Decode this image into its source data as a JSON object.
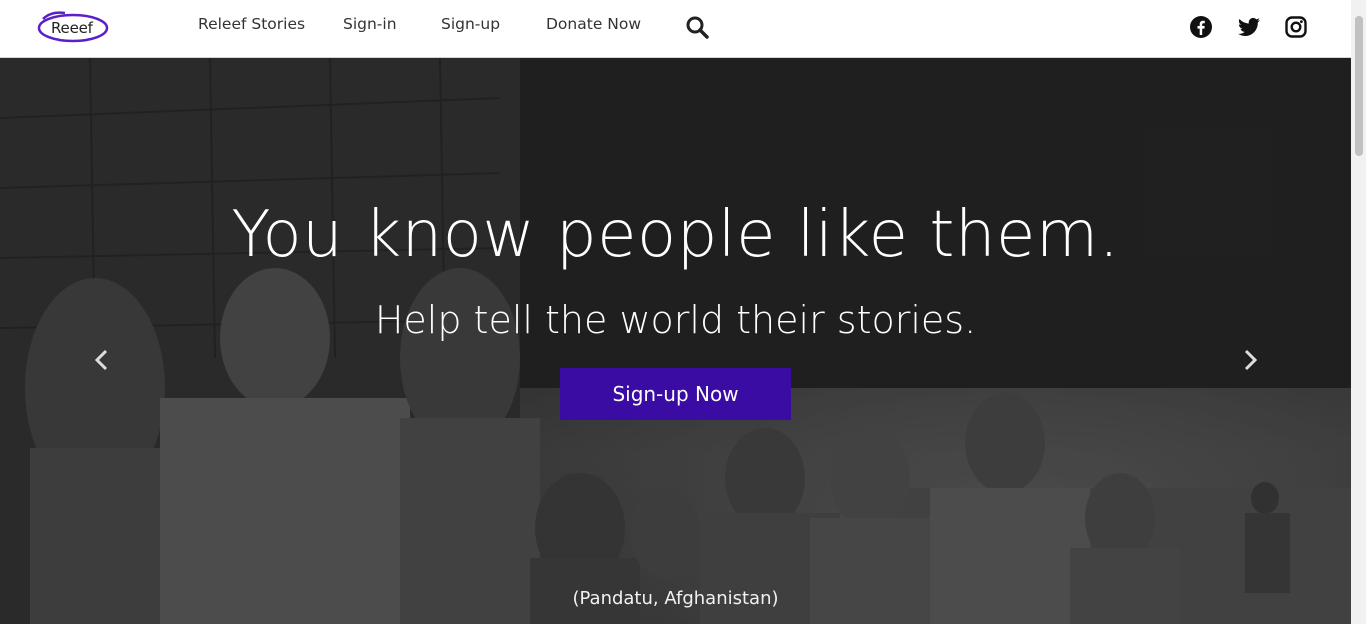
{
  "brand": {
    "logo_text": "Reeef",
    "accent": "#3a0ca3",
    "logo_ring_color": "#5b1fc9"
  },
  "nav": {
    "links": [
      "Releef Stories",
      "Sign-in",
      "Sign-up",
      "Donate Now"
    ],
    "search_icon": "search-icon",
    "social_icons": [
      "facebook-icon",
      "twitter-icon",
      "instagram-icon"
    ]
  },
  "hero": {
    "headline": "You know people like them.",
    "subhead": "Help tell the world their stories.",
    "cta_label": "Sign-up Now",
    "caption": "(Pandatu, Afghanistan)",
    "prev_icon": "chevron-left-icon",
    "next_icon": "chevron-right-icon"
  }
}
